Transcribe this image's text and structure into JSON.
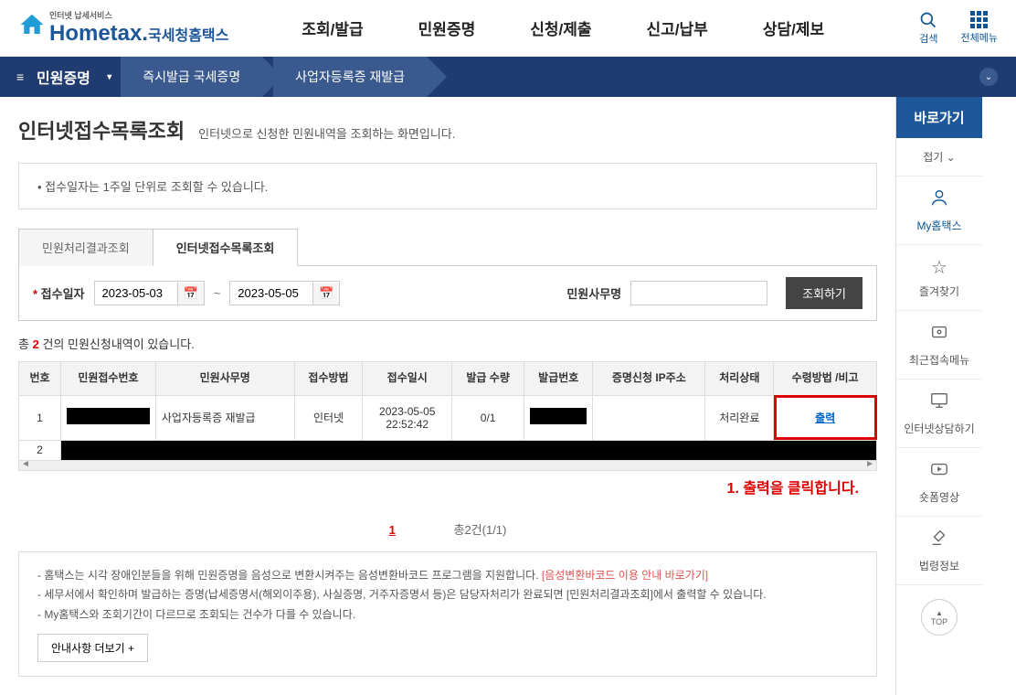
{
  "header": {
    "logo_small": "인터넷 납세서비스",
    "logo_main": "Hometax.",
    "logo_sub": "국세청홈택스",
    "nav": [
      "조회/발급",
      "민원증명",
      "신청/제출",
      "신고/납부",
      "상담/제보"
    ],
    "search_label": "검색",
    "allmenu_label": "전체메뉴"
  },
  "breadcrumb": {
    "current": "민원증명",
    "items": [
      "즉시발급 국세증명",
      "사업자등록증 재발급"
    ]
  },
  "page": {
    "title": "인터넷접수목록조회",
    "desc": "인터넷으로 신청한 민원내역을 조회하는 화면입니다.",
    "info": "접수일자는 1주일 단위로 조회할 수 있습니다."
  },
  "tabs": [
    "민원처리결과조회",
    "인터넷접수목록조회"
  ],
  "form": {
    "date_label": "접수일자",
    "date_from": "2023-05-03",
    "date_to": "2023-05-05",
    "sep": "~",
    "name_label": "민원사무명",
    "name_value": "",
    "search_btn": "조회하기"
  },
  "result": {
    "prefix": "총",
    "count": "2",
    "suffix": "건의 민원신청내역이 있습니다."
  },
  "table": {
    "headers": [
      "번호",
      "민원접수번호",
      "민원사무명",
      "접수방법",
      "접수일시",
      "발급\n수량",
      "발급번호",
      "증명신청\nIP주소",
      "처리상태",
      "수령방법\n/비고"
    ],
    "rows": [
      {
        "no": "1",
        "recv_no": "[REDACTED]",
        "name": "사업자등록증 재발급",
        "method": "인터넷",
        "datetime": "2023-05-05\n22:52:42",
        "qty": "0/1",
        "issue_no": "[REDACTED]",
        "ip": "",
        "status": "처리완료",
        "action": "출력"
      },
      {
        "no": "2",
        "redacted_row": true
      }
    ]
  },
  "annotation": "1. 출력을 클릭합니다.",
  "pagination": {
    "page": "1",
    "info": "총2건(1/1)"
  },
  "notes": {
    "line1_a": "- 홈택스는 시각 장애인분들을 위해 민원증명을 음성으로 변환시켜주는 음성변환바코드 프로그램을 지원합니다.",
    "line1_link": "[음성변환바코드 이용 안내 바로가기]",
    "line2": "- 세무서에서 확인하며 발급하는 증명(납세증명서(해외이주용), 사실증명, 거주자증명서 등)은 담당자처리가 완료되면 [민원처리결과조회]에서 출력할 수 있습니다.",
    "line3": "- My홈택스와 조회기간이 다르므로 조회되는 건수가 다를 수 있습니다.",
    "more_btn": "안내사항 더보기 +"
  },
  "sidebar": {
    "title": "바로가기",
    "items": [
      {
        "label": "접기 ⌄",
        "icon": ""
      },
      {
        "label": "My홈택스",
        "icon": "person",
        "active": true
      },
      {
        "label": "즐겨찾기",
        "icon": "star"
      },
      {
        "label": "최근접속메뉴",
        "icon": "recent"
      },
      {
        "label": "인터넷상담하기",
        "icon": "monitor"
      },
      {
        "label": "숏폼영상",
        "icon": "play"
      },
      {
        "label": "법령정보",
        "icon": "gavel"
      }
    ],
    "top": "TOP"
  }
}
